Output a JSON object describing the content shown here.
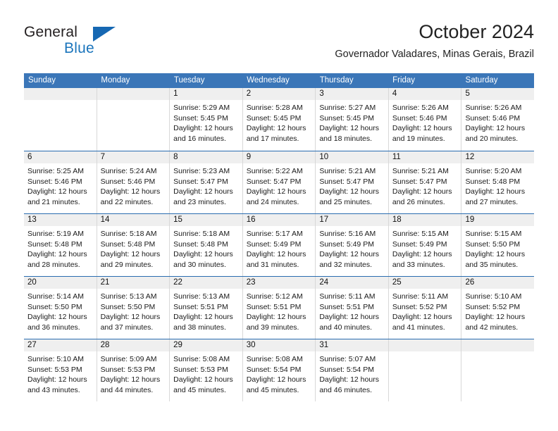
{
  "brand": {
    "name_part1": "General",
    "name_part2": "Blue",
    "triangle_icon": "triangle-icon",
    "accent_color": "#1b75bc"
  },
  "header": {
    "title": "October 2024",
    "subtitle": "Governador Valadares, Minas Gerais, Brazil"
  },
  "calendar": {
    "header_bg": "#3b76b8",
    "daynum_bg": "#efefef",
    "row_rule_color": "#2a6cb0",
    "weekday_headers": [
      "Sunday",
      "Monday",
      "Tuesday",
      "Wednesday",
      "Thursday",
      "Friday",
      "Saturday"
    ],
    "weeks": [
      [
        {
          "day": "",
          "lines": []
        },
        {
          "day": "",
          "lines": []
        },
        {
          "day": "1",
          "lines": [
            "Sunrise: 5:29 AM",
            "Sunset: 5:45 PM",
            "Daylight: 12 hours",
            "and 16 minutes."
          ]
        },
        {
          "day": "2",
          "lines": [
            "Sunrise: 5:28 AM",
            "Sunset: 5:45 PM",
            "Daylight: 12 hours",
            "and 17 minutes."
          ]
        },
        {
          "day": "3",
          "lines": [
            "Sunrise: 5:27 AM",
            "Sunset: 5:45 PM",
            "Daylight: 12 hours",
            "and 18 minutes."
          ]
        },
        {
          "day": "4",
          "lines": [
            "Sunrise: 5:26 AM",
            "Sunset: 5:46 PM",
            "Daylight: 12 hours",
            "and 19 minutes."
          ]
        },
        {
          "day": "5",
          "lines": [
            "Sunrise: 5:26 AM",
            "Sunset: 5:46 PM",
            "Daylight: 12 hours",
            "and 20 minutes."
          ]
        }
      ],
      [
        {
          "day": "6",
          "lines": [
            "Sunrise: 5:25 AM",
            "Sunset: 5:46 PM",
            "Daylight: 12 hours",
            "and 21 minutes."
          ]
        },
        {
          "day": "7",
          "lines": [
            "Sunrise: 5:24 AM",
            "Sunset: 5:46 PM",
            "Daylight: 12 hours",
            "and 22 minutes."
          ]
        },
        {
          "day": "8",
          "lines": [
            "Sunrise: 5:23 AM",
            "Sunset: 5:47 PM",
            "Daylight: 12 hours",
            "and 23 minutes."
          ]
        },
        {
          "day": "9",
          "lines": [
            "Sunrise: 5:22 AM",
            "Sunset: 5:47 PM",
            "Daylight: 12 hours",
            "and 24 minutes."
          ]
        },
        {
          "day": "10",
          "lines": [
            "Sunrise: 5:21 AM",
            "Sunset: 5:47 PM",
            "Daylight: 12 hours",
            "and 25 minutes."
          ]
        },
        {
          "day": "11",
          "lines": [
            "Sunrise: 5:21 AM",
            "Sunset: 5:47 PM",
            "Daylight: 12 hours",
            "and 26 minutes."
          ]
        },
        {
          "day": "12",
          "lines": [
            "Sunrise: 5:20 AM",
            "Sunset: 5:48 PM",
            "Daylight: 12 hours",
            "and 27 minutes."
          ]
        }
      ],
      [
        {
          "day": "13",
          "lines": [
            "Sunrise: 5:19 AM",
            "Sunset: 5:48 PM",
            "Daylight: 12 hours",
            "and 28 minutes."
          ]
        },
        {
          "day": "14",
          "lines": [
            "Sunrise: 5:18 AM",
            "Sunset: 5:48 PM",
            "Daylight: 12 hours",
            "and 29 minutes."
          ]
        },
        {
          "day": "15",
          "lines": [
            "Sunrise: 5:18 AM",
            "Sunset: 5:48 PM",
            "Daylight: 12 hours",
            "and 30 minutes."
          ]
        },
        {
          "day": "16",
          "lines": [
            "Sunrise: 5:17 AM",
            "Sunset: 5:49 PM",
            "Daylight: 12 hours",
            "and 31 minutes."
          ]
        },
        {
          "day": "17",
          "lines": [
            "Sunrise: 5:16 AM",
            "Sunset: 5:49 PM",
            "Daylight: 12 hours",
            "and 32 minutes."
          ]
        },
        {
          "day": "18",
          "lines": [
            "Sunrise: 5:15 AM",
            "Sunset: 5:49 PM",
            "Daylight: 12 hours",
            "and 33 minutes."
          ]
        },
        {
          "day": "19",
          "lines": [
            "Sunrise: 5:15 AM",
            "Sunset: 5:50 PM",
            "Daylight: 12 hours",
            "and 35 minutes."
          ]
        }
      ],
      [
        {
          "day": "20",
          "lines": [
            "Sunrise: 5:14 AM",
            "Sunset: 5:50 PM",
            "Daylight: 12 hours",
            "and 36 minutes."
          ]
        },
        {
          "day": "21",
          "lines": [
            "Sunrise: 5:13 AM",
            "Sunset: 5:50 PM",
            "Daylight: 12 hours",
            "and 37 minutes."
          ]
        },
        {
          "day": "22",
          "lines": [
            "Sunrise: 5:13 AM",
            "Sunset: 5:51 PM",
            "Daylight: 12 hours",
            "and 38 minutes."
          ]
        },
        {
          "day": "23",
          "lines": [
            "Sunrise: 5:12 AM",
            "Sunset: 5:51 PM",
            "Daylight: 12 hours",
            "and 39 minutes."
          ]
        },
        {
          "day": "24",
          "lines": [
            "Sunrise: 5:11 AM",
            "Sunset: 5:51 PM",
            "Daylight: 12 hours",
            "and 40 minutes."
          ]
        },
        {
          "day": "25",
          "lines": [
            "Sunrise: 5:11 AM",
            "Sunset: 5:52 PM",
            "Daylight: 12 hours",
            "and 41 minutes."
          ]
        },
        {
          "day": "26",
          "lines": [
            "Sunrise: 5:10 AM",
            "Sunset: 5:52 PM",
            "Daylight: 12 hours",
            "and 42 minutes."
          ]
        }
      ],
      [
        {
          "day": "27",
          "lines": [
            "Sunrise: 5:10 AM",
            "Sunset: 5:53 PM",
            "Daylight: 12 hours",
            "and 43 minutes."
          ]
        },
        {
          "day": "28",
          "lines": [
            "Sunrise: 5:09 AM",
            "Sunset: 5:53 PM",
            "Daylight: 12 hours",
            "and 44 minutes."
          ]
        },
        {
          "day": "29",
          "lines": [
            "Sunrise: 5:08 AM",
            "Sunset: 5:53 PM",
            "Daylight: 12 hours",
            "and 45 minutes."
          ]
        },
        {
          "day": "30",
          "lines": [
            "Sunrise: 5:08 AM",
            "Sunset: 5:54 PM",
            "Daylight: 12 hours",
            "and 45 minutes."
          ]
        },
        {
          "day": "31",
          "lines": [
            "Sunrise: 5:07 AM",
            "Sunset: 5:54 PM",
            "Daylight: 12 hours",
            "and 46 minutes."
          ]
        },
        {
          "day": "",
          "lines": []
        },
        {
          "day": "",
          "lines": []
        }
      ]
    ]
  }
}
